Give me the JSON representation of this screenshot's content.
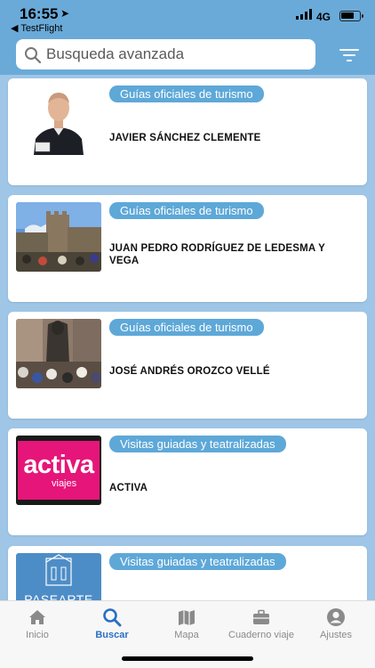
{
  "status": {
    "time": "16:55",
    "back_app": "◀ TestFlight",
    "network": "4G"
  },
  "search": {
    "placeholder": "Busqueda avanzada"
  },
  "cards": [
    {
      "tag": "Guías oficiales de turismo",
      "name": "JAVIER SÁNCHEZ CLEMENTE"
    },
    {
      "tag": "Guías oficiales de turismo",
      "name": "JUAN PEDRO RODRÍGUEZ DE LEDESMA Y VEGA"
    },
    {
      "tag": "Guías oficiales de turismo",
      "name": "JOSÉ ANDRÉS OROZCO VELLÉ"
    },
    {
      "tag": "Visitas guiadas y teatralizadas",
      "name": "ACTIVA"
    },
    {
      "tag": "Visitas guiadas y teatralizadas",
      "name": ""
    }
  ],
  "logos": {
    "activa_main": "activa",
    "activa_sub": "viajes",
    "paseart": "PASEARTE"
  },
  "tabs": [
    {
      "label": "Inicio",
      "icon": "home-icon"
    },
    {
      "label": "Buscar",
      "icon": "search-icon"
    },
    {
      "label": "Mapa",
      "icon": "map-icon"
    },
    {
      "label": "Cuaderno viaje",
      "icon": "briefcase-icon"
    },
    {
      "label": "Ajustes",
      "icon": "user-icon"
    }
  ],
  "colors": {
    "header": "#6aaad9",
    "tag": "#5ea8d8",
    "active_tab": "#2a6fc4",
    "activa_pink": "#e6157a",
    "paseart_blue": "#4d8dc7"
  }
}
